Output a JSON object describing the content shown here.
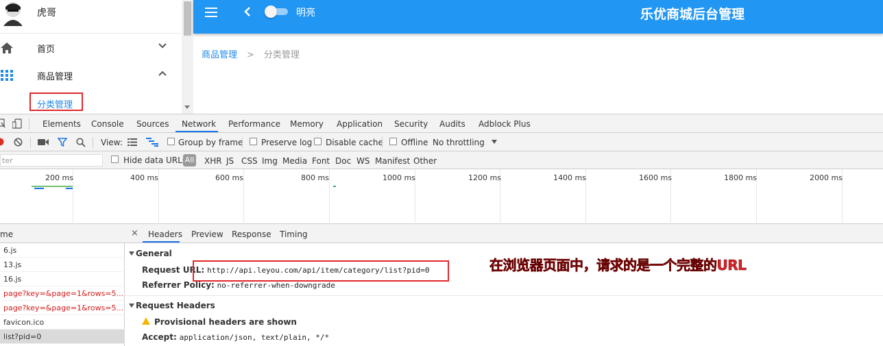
{
  "sidebar": {
    "user_name": "虎哥",
    "items": [
      {
        "label": "首页",
        "icon": "home-icon",
        "expanded": false
      },
      {
        "label": "商品管理",
        "icon": "grid-icon",
        "expanded": true
      }
    ],
    "active_sub_item": "分类管理"
  },
  "topbar": {
    "theme_label": "明亮",
    "title": "乐优商城后台管理",
    "color": "#2196f3"
  },
  "breadcrumb": {
    "parent": "商品管理",
    "separator": ">",
    "current": "分类管理"
  },
  "devtools": {
    "tabs": [
      "Elements",
      "Console",
      "Sources",
      "Network",
      "Performance",
      "Memory",
      "Application",
      "Security",
      "Audits",
      "Adblock Plus"
    ],
    "active_tab": "Network",
    "toolbar": {
      "view_label": "View:",
      "group_by_frame": "Group by frame",
      "preserve_log": "Preserve log",
      "disable_cache": "Disable cache",
      "offline": "Offline",
      "throttling": "No throttling"
    },
    "filter": {
      "placeholder": "ter",
      "hide_data_urls": "Hide data URLs",
      "types": [
        "All",
        "XHR",
        "JS",
        "CSS",
        "Img",
        "Media",
        "Font",
        "Doc",
        "WS",
        "Manifest",
        "Other"
      ]
    },
    "timeline_ticks": [
      "200 ms",
      "400 ms",
      "600 ms",
      "800 ms",
      "1000 ms",
      "1200 ms",
      "1400 ms",
      "1600 ms",
      "1800 ms",
      "2000 ms"
    ],
    "request_list": {
      "header": "me",
      "rows": [
        {
          "name": "6.js",
          "error": false,
          "selected": false
        },
        {
          "name": "13.js",
          "error": false,
          "selected": false
        },
        {
          "name": "16.js",
          "error": false,
          "selected": false
        },
        {
          "name": "page?key=&page=1&rows=5...",
          "error": true,
          "selected": false
        },
        {
          "name": "page?key=&page=1&rows=5...",
          "error": true,
          "selected": false
        },
        {
          "name": "favicon.ico",
          "error": false,
          "selected": false
        },
        {
          "name": "list?pid=0",
          "error": false,
          "selected": true
        }
      ]
    },
    "detail": {
      "close": "×",
      "tabs": [
        "Headers",
        "Preview",
        "Response",
        "Timing"
      ],
      "active_tab": "Headers",
      "general_title": "General",
      "request_url_key": "Request URL:",
      "request_url_value": "http://api.leyou.com/api/item/category/list?pid=0",
      "referrer_key": "Referrer Policy:",
      "referrer_value": "no-referrer-when-downgrade",
      "request_headers_title": "Request Headers",
      "provisional_warning": "Provisional headers are shown",
      "accept_key": "Accept:",
      "accept_value": "application/json, text/plain, */*"
    }
  },
  "annotation": {
    "text": "在浏览器页面中，请求的是一个完整的URL",
    "color": "#e0262b"
  }
}
